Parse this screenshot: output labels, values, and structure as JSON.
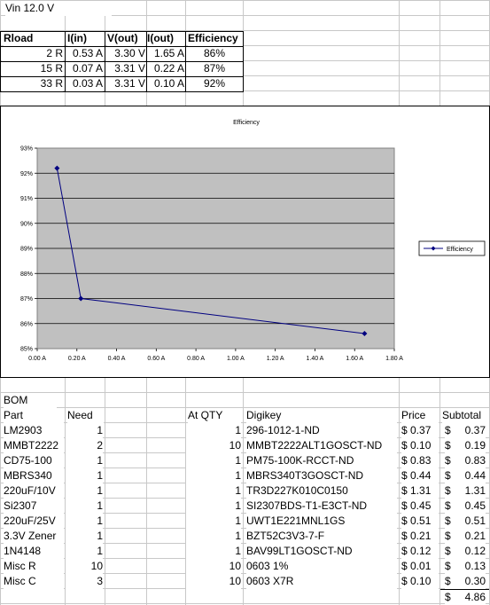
{
  "vin_label": "Vin 12.0 V",
  "load_table": {
    "headers": [
      "Rload",
      "I(in)",
      "V(out)",
      "I(out)",
      "Efficiency"
    ],
    "rows": [
      [
        "2 R",
        "0.53 A",
        "3.30 V",
        "1.65 A",
        "86%"
      ],
      [
        "15 R",
        "0.07 A",
        "3.31 V",
        "0.22 A",
        "87%"
      ],
      [
        "33 R",
        "0.03 A",
        "3.31 V",
        "0.10 A",
        "92%"
      ]
    ]
  },
  "chart_data": {
    "type": "line",
    "title": "Efficiency",
    "series": [
      {
        "name": "Efficiency",
        "x": [
          1.65,
          0.22,
          0.1
        ],
        "y": [
          0.856,
          0.87,
          0.922
        ],
        "color": "#000080"
      }
    ],
    "xlim": [
      0,
      1.8
    ],
    "ylim": [
      0.85,
      0.93
    ],
    "x_ticks": [
      "0.00 A",
      "0.20 A",
      "0.40 A",
      "0.60 A",
      "0.80 A",
      "1.00 A",
      "1.20 A",
      "1.40 A",
      "1.60 A",
      "1.80 A"
    ],
    "y_ticks": [
      "85%",
      "86%",
      "87%",
      "88%",
      "89%",
      "90%",
      "91%",
      "92%",
      "93%"
    ],
    "grid": true,
    "legend_position": "right",
    "plot_background": "#c0c0c0"
  },
  "bom": {
    "title": "BOM",
    "headers": {
      "part": "Part",
      "need": "Need",
      "at_qty": "At QTY",
      "digikey": "Digikey",
      "price": "Price",
      "subtotal": "Subtotal"
    },
    "rows": [
      {
        "part": "LM2903",
        "need": "1",
        "at_qty": "1",
        "digikey": "296-1012-1-ND",
        "price": "$ 0.37",
        "subtotal": "0.37"
      },
      {
        "part": "MMBT2222",
        "need": "2",
        "at_qty": "10",
        "digikey": "MMBT2222ALT1GOSCT-ND",
        "price": "$ 0.10",
        "subtotal": "0.19"
      },
      {
        "part": "CD75-100",
        "need": "1",
        "at_qty": "1",
        "digikey": "PM75-100K-RCCT-ND",
        "price": "$ 0.83",
        "subtotal": "0.83"
      },
      {
        "part": "MBRS340",
        "need": "1",
        "at_qty": "1",
        "digikey": "MBRS340T3GOSCT-ND",
        "price": "$ 0.44",
        "subtotal": "0.44"
      },
      {
        "part": "220uF/10V",
        "need": "1",
        "at_qty": "1",
        "digikey": "TR3D227K010C0150",
        "price": "$ 1.31",
        "subtotal": "1.31"
      },
      {
        "part": "Si2307",
        "need": "1",
        "at_qty": "1",
        "digikey": "SI2307BDS-T1-E3CT-ND",
        "price": "$ 0.45",
        "subtotal": "0.45"
      },
      {
        "part": "220uF/25V",
        "need": "1",
        "at_qty": "1",
        "digikey": "UWT1E221MNL1GS",
        "price": "$ 0.51",
        "subtotal": "0.51"
      },
      {
        "part": "3.3V Zener",
        "need": "1",
        "at_qty": "1",
        "digikey": "BZT52C3V3-7-F",
        "price": "$ 0.21",
        "subtotal": "0.21"
      },
      {
        "part": "1N4148",
        "need": "1",
        "at_qty": "1",
        "digikey": "BAV99LT1GOSCT-ND",
        "price": "$ 0.12",
        "subtotal": "0.12"
      },
      {
        "part": "Misc R",
        "need": "10",
        "at_qty": "10",
        "digikey": "0603 1%",
        "price": "$ 0.01",
        "subtotal": "0.13"
      },
      {
        "part": "Misc C",
        "need": "3",
        "at_qty": "10",
        "digikey": "0603 X7R",
        "price": "$ 0.10",
        "subtotal": "0.30"
      }
    ],
    "currency": "$",
    "total": "4.86"
  }
}
